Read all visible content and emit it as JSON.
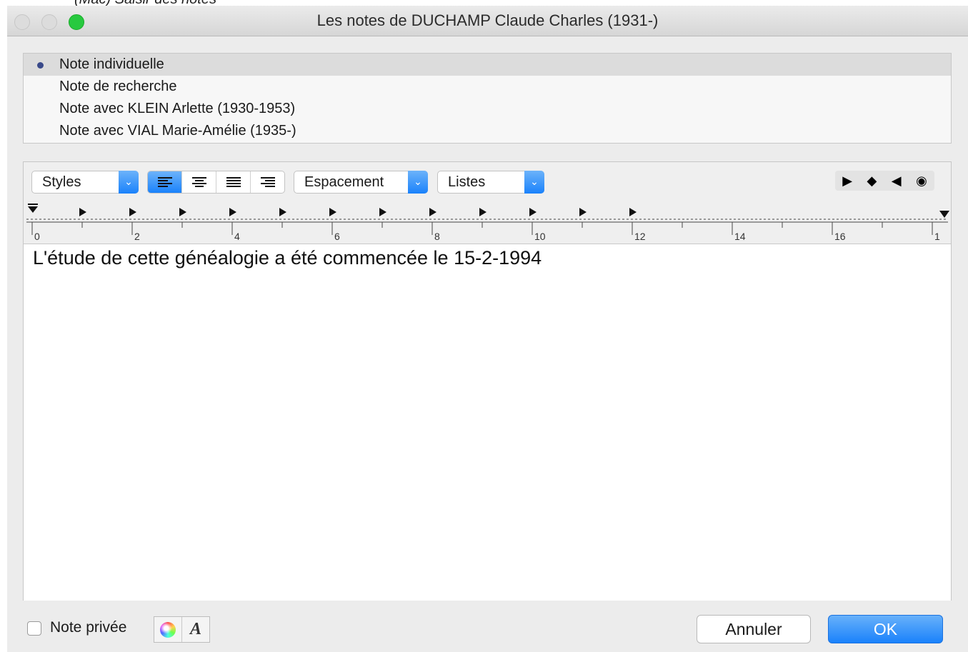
{
  "caption": "(Mac) Saisir des notes",
  "window": {
    "title": "Les notes de DUCHAMP Claude Charles (1931-)"
  },
  "notes": [
    {
      "label": "Note individuelle",
      "selected": true
    },
    {
      "label": "Note de recherche",
      "selected": false
    },
    {
      "label": "Note avec KLEIN Arlette (1930-1953)",
      "selected": false
    },
    {
      "label": "Note avec VIAL Marie-Amélie (1935-)",
      "selected": false
    }
  ],
  "toolbar": {
    "styles_label": "Styles",
    "spacing_label": "Espacement",
    "lists_label": "Listes",
    "alignments": [
      "align-left",
      "align-center",
      "align-justify",
      "align-right"
    ],
    "active_alignment": "align-left",
    "tab_tools": [
      "tab-right-icon",
      "tab-decimal-icon",
      "tab-left-icon",
      "tab-center-icon"
    ]
  },
  "ruler": {
    "labels": [
      "0",
      "2",
      "4",
      "6",
      "8",
      "10",
      "12",
      "14",
      "16",
      "1"
    ]
  },
  "document": {
    "text": "L'étude de cette généalogie a été commencée le 15-2-1994"
  },
  "footer": {
    "private_label": "Note privée",
    "private_checked": false,
    "cancel_label": "Annuler",
    "ok_label": "OK"
  },
  "colors": {
    "accent": "#1a82fb",
    "selection_row": "#dcdcdc",
    "zoom_light": "#27c93f"
  }
}
